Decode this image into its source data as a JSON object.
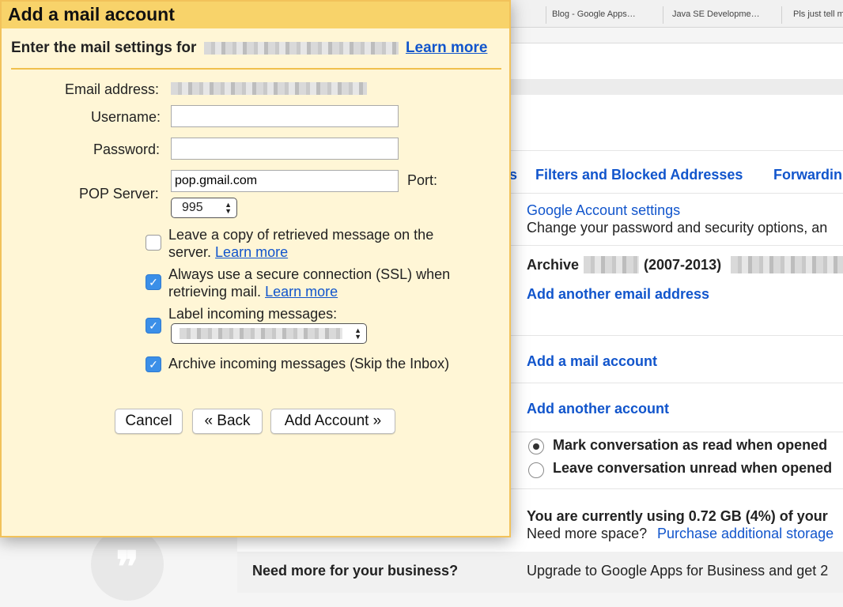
{
  "bookmarks": [
    "Blog - Google Apps…",
    "Java SE Developme…",
    "Pls just tell m"
  ],
  "settings": {
    "tabs": [
      "s",
      "Filters and Blocked Addresses",
      "Forwardin"
    ],
    "google_account_link": "Google Account settings",
    "google_account_desc": "Change your password and security options, an",
    "archive_label": "Archive",
    "archive_years": "(2007-2013)",
    "add_email_link": "Add another email address",
    "add_mail_link": "Add a mail account",
    "add_another_link": "Add another account",
    "radio_read": "Mark conversation as read when opened",
    "radio_unread": "Leave conversation unread when opened",
    "storage_text": "You are currently using 0.72 GB (4%) of your",
    "more_space_text": "Need more space?",
    "purchase_link": "Purchase additional storage",
    "business_label": "Need more for your business?",
    "business_text": "Upgrade to Google Apps for Business and get 2"
  },
  "dialog": {
    "title": "Add a mail account",
    "header_text": "Enter the mail settings for",
    "learn_more": "Learn more",
    "email_label": "Email address:",
    "username_label": "Username:",
    "username_value": "",
    "password_label": "Password:",
    "password_value": "",
    "pop_label": "POP Server:",
    "pop_value": "pop.gmail.com",
    "port_label": "Port:",
    "port_value": "995",
    "opt_leave_copy": "Leave a copy of retrieved message on the server.",
    "opt_leave_copy_checked": false,
    "opt_ssl": "Always use a secure connection (SSL) when retrieving mail.",
    "opt_ssl_checked": true,
    "opt_label": "Label incoming messages:",
    "opt_label_checked": true,
    "opt_archive": "Archive incoming messages (Skip the Inbox)",
    "opt_archive_checked": true,
    "cancel": "Cancel",
    "back": "« Back",
    "add_account": "Add Account »"
  }
}
